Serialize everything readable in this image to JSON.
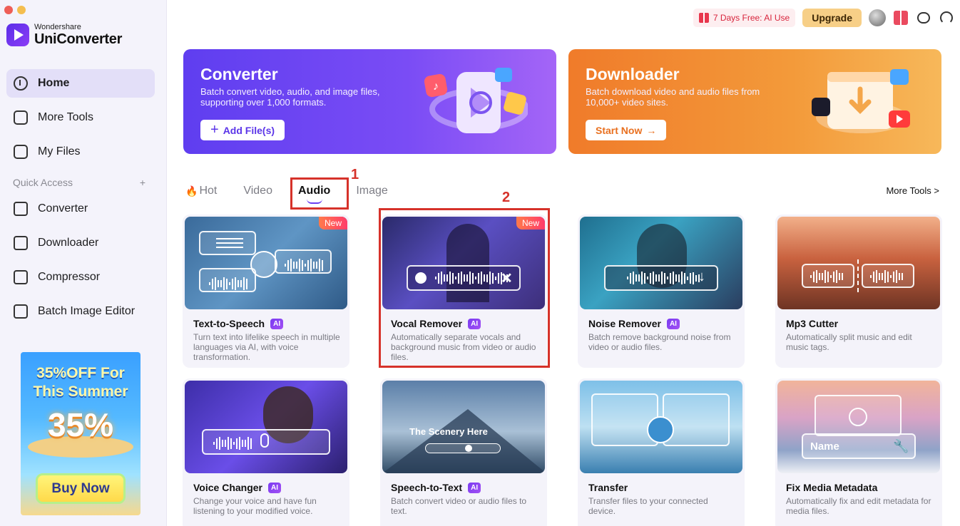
{
  "brand": {
    "line1": "Wondershare",
    "line2": "UniConverter"
  },
  "nav": [
    {
      "label": "Home",
      "icon": "home-icon",
      "active": true
    },
    {
      "label": "More Tools",
      "icon": "toolbox-icon"
    },
    {
      "label": "My Files",
      "icon": "file-icon"
    }
  ],
  "quick_access": {
    "label": "Quick Access",
    "add": "+",
    "items": [
      {
        "label": "Converter",
        "icon": "converter-icon"
      },
      {
        "label": "Downloader",
        "icon": "download-icon"
      },
      {
        "label": "Compressor",
        "icon": "compress-icon"
      },
      {
        "label": "Batch Image Editor",
        "icon": "image-edit-icon"
      }
    ]
  },
  "promo": {
    "title_line1": "35%OFF For",
    "title_line2": "This Summer",
    "big": "35%",
    "button": "Buy Now"
  },
  "topbar": {
    "trial": "7 Days Free: AI Use",
    "upgrade": "Upgrade"
  },
  "banners": {
    "converter": {
      "title": "Converter",
      "desc": "Batch convert video, audio, and image files, supporting over 1,000 formats.",
      "button": "Add File(s)",
      "button_icon": "+"
    },
    "downloader": {
      "title": "Downloader",
      "desc": "Batch download video and audio files from 10,000+ video sites.",
      "button": "Start Now",
      "button_icon": "→"
    }
  },
  "tabs": {
    "hot": "Hot",
    "hot_icon": "🔥",
    "video": "Video",
    "audio": "Audio",
    "image": "Image",
    "active": "Audio"
  },
  "more_tools": "More Tools >",
  "annotations": {
    "one": "1",
    "two": "2"
  },
  "cards": [
    {
      "title": "Text-to-Speech",
      "ai": "AI",
      "new": "New",
      "desc": "Turn text into lifelike speech in multiple languages via AI, with voice transformation."
    },
    {
      "title": "Vocal Remover",
      "ai": "AI",
      "new": "New",
      "desc": "Automatically separate vocals and background music from video or audio files."
    },
    {
      "title": "Noise Remover",
      "ai": "AI",
      "desc": "Batch remove background noise from video or audio files."
    },
    {
      "title": "Mp3 Cutter",
      "desc": "Automatically split music and edit music tags."
    },
    {
      "title": "Voice Changer",
      "ai": "AI",
      "desc": "Change your voice and have fun listening to your modified voice."
    },
    {
      "title": "Speech-to-Text",
      "ai": "AI",
      "desc": "Batch convert video or audio files to text.",
      "thumb_text": "The Scenery Here"
    },
    {
      "title": "Transfer",
      "desc": "Transfer files to your connected device."
    },
    {
      "title": "Fix Media Metadata",
      "desc": "Automatically fix and edit metadata for media files.",
      "thumb_text": "Name"
    }
  ],
  "colors": {
    "accent": "#6a3ff2",
    "highlight": "#d6322a",
    "trial": "#d8243c",
    "upgrade_bg": "#f7cf87"
  }
}
